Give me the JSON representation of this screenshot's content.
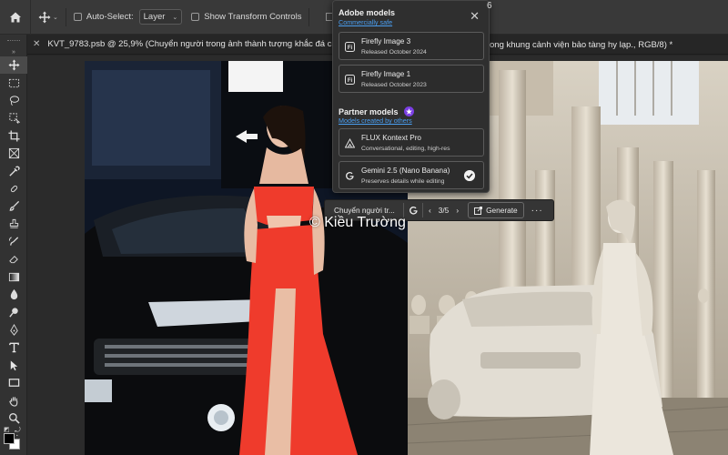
{
  "options_bar": {
    "auto_select_label": "Auto-Select:",
    "auto_select_value": "Layer",
    "show_transform_label": "Show Transform Controls"
  },
  "tabs": {
    "tab1_title": "KVT_9783.psb @ 25,9% (Chuyển người trong ảnh thành tượng khắc đá cẩm thạch",
    "tab2_title": "ong khung cảnh viện bảo tàng hy lạp., RGB/8) *"
  },
  "title_fragment": "6",
  "panel": {
    "adobe_section_title": "Adobe models",
    "adobe_section_sub": "Commercially safe",
    "partner_section_title": "Partner models",
    "partner_section_sub": "Models created by others",
    "models": [
      {
        "name": "Firefly Image 3",
        "desc": "Released October 2024"
      },
      {
        "name": "Firefly Image 1",
        "desc": "Released October 2023"
      },
      {
        "name": "FLUX Kontext Pro",
        "desc": "Conversational, editing, high-res"
      },
      {
        "name": "Gemini 2.5 (Nano Banana)",
        "desc": "Preserves details while editing"
      }
    ],
    "selected_model": "Gemini 2.5 (Nano Banana)"
  },
  "taskbar": {
    "prompt_text": "Chuyển người tr...",
    "page_indicator": "3/5",
    "generate_label": "Generate"
  },
  "watermark": "© Kiều Trường",
  "colors": {
    "accent_link": "#4a9ef0",
    "partner_badge": "#7b3fe4",
    "dress_red": "#ef3b2c"
  }
}
